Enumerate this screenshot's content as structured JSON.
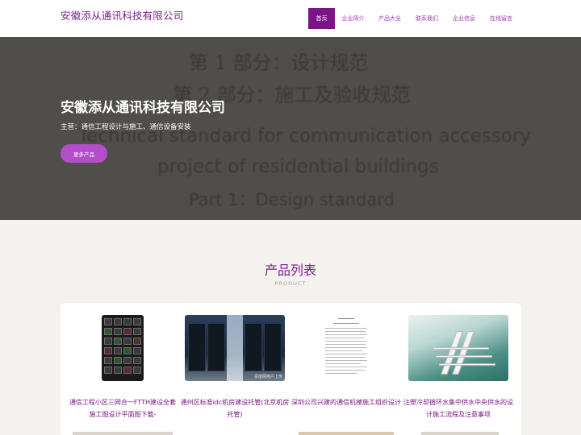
{
  "header": {
    "logo": "安徽添从通讯科技有限公司",
    "nav": [
      {
        "label": "首页",
        "active": true
      },
      {
        "label": "企业简介",
        "active": false
      },
      {
        "label": "产品大全",
        "active": false
      },
      {
        "label": "联系我们",
        "active": false
      },
      {
        "label": "企业信息",
        "active": false
      },
      {
        "label": "在线留言",
        "active": false
      }
    ]
  },
  "hero": {
    "background_text": [
      "第 1 部分：设计规范",
      "第 2 部分：施工及验收规范",
      "Technical standard for communication accessory",
      "project of residential buildings",
      "Part 1：Design standard"
    ],
    "title": "安徽添从通讯科技有限公司",
    "subtitle": "主营：通信工程设计与施工、通信设备安装",
    "button": "更多产品"
  },
  "products_section": {
    "title": "产品列表",
    "subtitle": "PRODUCT",
    "items": [
      {
        "name": "通信工程小区三网合一FTTH建设全套施工图设计平面图下载-",
        "image": "monitor-grid-image"
      },
      {
        "name": "通州区标准idc机房建设托管(北京机房托管)",
        "image": "server-room-image",
        "watermark": "百度网用户上传"
      },
      {
        "name": "深圳公司兴建的通信机楼施工组织设计",
        "image": "document-page-image"
      },
      {
        "name": "注塑冷却循环水集中供水中央供水的设计施工流程及注意事项",
        "image": "pipe-model-image"
      }
    ]
  },
  "colors": {
    "brand": "#7a1f8c",
    "nav_active_bg": "#7b1485",
    "button_bg": "#b44ecb",
    "page_bg": "#f4f2ee"
  }
}
